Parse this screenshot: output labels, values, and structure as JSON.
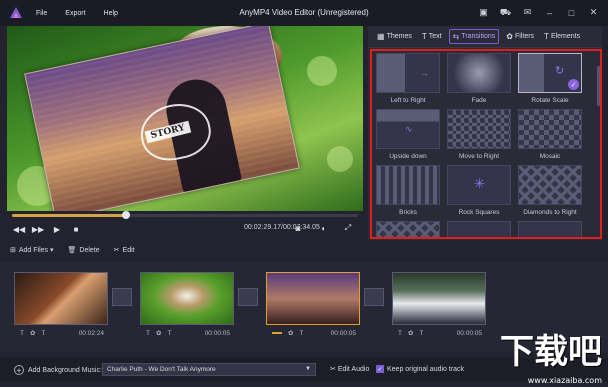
{
  "window": {
    "title": "AnyMP4 Video Editor (Unregistered)",
    "menu": [
      "File",
      "Export",
      "Help"
    ]
  },
  "preview": {
    "overlay_text": "STORY",
    "current_time": "00:02:29.17",
    "total_time": "00:07:34.05",
    "progress_fraction": 0.33
  },
  "right_panel": {
    "tabs": [
      {
        "label": "Themes",
        "icon": "themes-icon"
      },
      {
        "label": "Text",
        "icon": "text-icon"
      },
      {
        "label": "Transitions",
        "icon": "transitions-icon",
        "active": true
      },
      {
        "label": "Filters",
        "icon": "filters-icon"
      },
      {
        "label": "Elements",
        "icon": "elements-icon"
      }
    ],
    "transitions": [
      {
        "label": "Left to Right"
      },
      {
        "label": "Fade"
      },
      {
        "label": "Rotate Scale",
        "selected": true
      },
      {
        "label": "Upside down"
      },
      {
        "label": "Move to Right"
      },
      {
        "label": "Mosaic"
      },
      {
        "label": "Bricks"
      },
      {
        "label": "Rock Squares"
      },
      {
        "label": "Diamonds to Right"
      },
      {
        "label": ""
      },
      {
        "label": ""
      },
      {
        "label": ""
      }
    ]
  },
  "timeline_toolbar": {
    "add_files": "Add Files",
    "delete": "Delete",
    "edit": "Edit"
  },
  "clips": [
    {
      "duration": "00:02:24"
    },
    {
      "duration": "00:00:05"
    },
    {
      "duration": "00:00:05"
    },
    {
      "duration": "00:00:05"
    }
  ],
  "bottom_bar": {
    "add_music_label": "Add Background Music:",
    "music_selected": "Charlie Puth - We Don't Talk Anymore",
    "edit_audio": "Edit Audio",
    "keep_original": "Keep original audio track"
  },
  "watermark": {
    "text": "下载吧",
    "url": "www.xiazaiba.com"
  },
  "colors": {
    "accent": "#7b5fd0",
    "highlight_border": "#e11d1d",
    "progress": "#d6a24a"
  }
}
